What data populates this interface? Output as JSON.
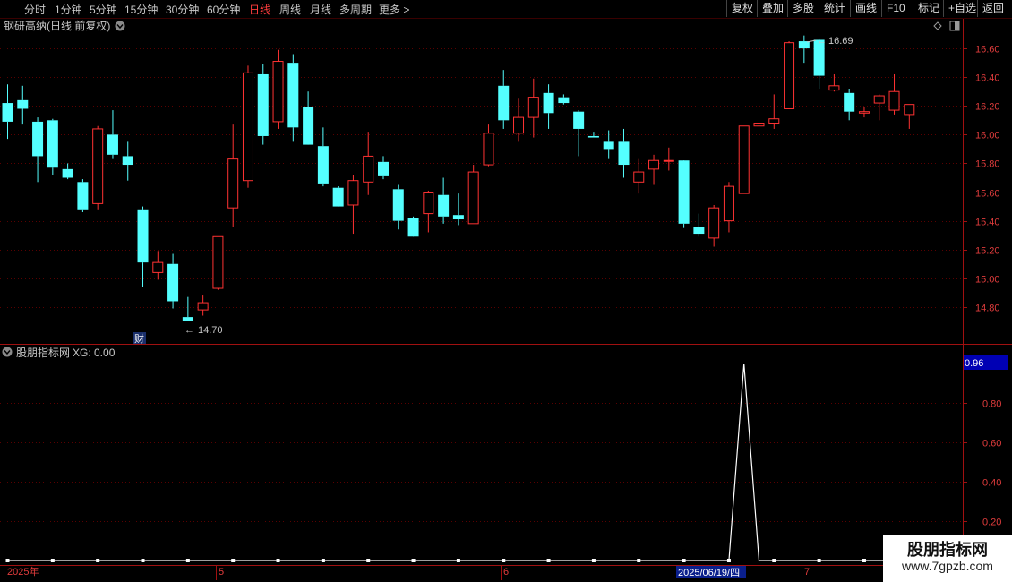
{
  "toolbar": {
    "periods": [
      "分时",
      "1分钟",
      "5分钟",
      "15分钟",
      "30分钟",
      "60分钟",
      "日线",
      "周线",
      "月线",
      "多周期",
      "更多 >"
    ],
    "active_period": "日线",
    "buttons": [
      "复权",
      "叠加",
      "多股",
      "统计",
      "画线",
      "F10",
      "标记",
      "+自选",
      "返回"
    ]
  },
  "main_panel": {
    "title": "钢研高纳(日线 前复权)",
    "y_axis": {
      "ticks": [
        "16.60",
        "16.40",
        "16.20",
        "16.00",
        "15.80",
        "15.60",
        "15.40",
        "15.20",
        "15.00",
        "14.80"
      ],
      "ylim": [
        14.55,
        16.8
      ]
    },
    "high_label": "16.69",
    "low_label": "14.70",
    "cai_badge": "财",
    "up_color": "#ff3232",
    "down_color": "#54ffff"
  },
  "indicator_panel": {
    "title": "股朋指标网",
    "xg_label": "XG: 0.00",
    "current_value_badge": "0.96",
    "y_axis_ticks": [
      "0.80",
      "0.60",
      "0.40",
      "0.20"
    ]
  },
  "x_axis": {
    "labels": [
      "2025年",
      "5",
      "6",
      "7"
    ],
    "highlight_date": "2025/06/19/四"
  },
  "watermark": {
    "line1": "股朋指标网",
    "line2": "www.7gpzb.com"
  },
  "chart_data": {
    "type": "candlestick",
    "ohlc": [
      [
        16.22,
        16.35,
        15.97,
        16.09
      ],
      [
        16.24,
        16.34,
        16.07,
        16.18
      ],
      [
        16.09,
        16.12,
        15.67,
        15.85
      ],
      [
        16.1,
        16.11,
        15.72,
        15.77
      ],
      [
        15.76,
        15.8,
        15.69,
        15.7
      ],
      [
        15.67,
        15.69,
        15.46,
        15.48
      ],
      [
        15.52,
        16.06,
        15.48,
        16.04
      ],
      [
        16.0,
        16.17,
        15.83,
        15.86
      ],
      [
        15.85,
        15.95,
        15.68,
        15.79
      ],
      [
        15.48,
        15.5,
        14.94,
        15.11
      ],
      [
        15.04,
        15.19,
        14.99,
        15.11
      ],
      [
        15.1,
        15.17,
        14.79,
        14.84
      ],
      [
        14.73,
        14.87,
        14.71,
        14.7
      ],
      [
        14.78,
        14.88,
        14.74,
        14.83
      ],
      [
        14.93,
        15.29,
        14.92,
        15.29
      ],
      [
        15.49,
        16.07,
        15.36,
        15.83
      ],
      [
        15.68,
        16.48,
        15.63,
        16.43
      ],
      [
        16.42,
        16.49,
        15.93,
        15.99
      ],
      [
        16.09,
        16.59,
        16.04,
        16.51
      ],
      [
        16.5,
        16.56,
        15.95,
        16.05
      ],
      [
        16.19,
        16.3,
        15.94,
        15.93
      ],
      [
        15.92,
        16.05,
        15.64,
        15.66
      ],
      [
        15.63,
        15.64,
        15.51,
        15.5
      ],
      [
        15.51,
        15.72,
        15.31,
        15.68
      ],
      [
        15.67,
        16.02,
        15.58,
        15.85
      ],
      [
        15.81,
        15.85,
        15.69,
        15.71
      ],
      [
        15.62,
        15.65,
        15.34,
        15.4
      ],
      [
        15.42,
        15.43,
        15.3,
        15.29
      ],
      [
        15.45,
        15.61,
        15.32,
        15.6
      ],
      [
        15.58,
        15.7,
        15.38,
        15.43
      ],
      [
        15.44,
        15.59,
        15.37,
        15.41
      ],
      [
        15.38,
        15.79,
        15.39,
        15.74
      ],
      [
        15.79,
        16.07,
        15.78,
        16.01
      ],
      [
        16.34,
        16.45,
        16.04,
        16.1
      ],
      [
        16.01,
        16.25,
        15.95,
        16.12
      ],
      [
        16.12,
        16.39,
        15.98,
        16.26
      ],
      [
        16.29,
        16.35,
        16.04,
        16.15
      ],
      [
        16.26,
        16.28,
        16.21,
        16.22
      ],
      [
        16.16,
        16.17,
        15.85,
        16.04
      ],
      [
        15.99,
        16.02,
        15.98,
        15.98
      ],
      [
        15.95,
        16.03,
        15.83,
        15.9
      ],
      [
        15.95,
        16.04,
        15.7,
        15.79
      ],
      [
        15.67,
        15.83,
        15.59,
        15.74
      ],
      [
        15.76,
        15.86,
        15.65,
        15.82
      ],
      [
        15.82,
        15.91,
        15.75,
        15.82
      ],
      [
        15.82,
        15.81,
        15.35,
        15.38
      ],
      [
        15.36,
        15.45,
        15.29,
        15.31
      ],
      [
        15.28,
        15.51,
        15.22,
        15.49
      ],
      [
        15.4,
        15.67,
        15.32,
        15.64
      ],
      [
        15.59,
        16.06,
        15.61,
        16.06
      ],
      [
        16.06,
        16.37,
        16.02,
        16.08
      ],
      [
        16.08,
        16.28,
        16.04,
        16.11
      ],
      [
        16.18,
        16.65,
        16.18,
        16.64
      ],
      [
        16.65,
        16.69,
        16.5,
        16.6
      ],
      [
        16.66,
        16.67,
        16.32,
        16.41
      ],
      [
        16.31,
        16.42,
        16.3,
        16.34
      ],
      [
        16.29,
        16.32,
        16.1,
        16.16
      ],
      [
        16.15,
        16.19,
        16.12,
        16.16
      ],
      [
        16.22,
        16.28,
        16.1,
        16.27
      ],
      [
        16.17,
        16.42,
        16.14,
        16.3
      ],
      [
        16.14,
        16.2,
        16.04,
        16.21
      ]
    ],
    "indicator": {
      "name": "XG",
      "values": [
        0,
        0,
        0,
        0,
        0,
        0,
        0,
        0,
        0,
        0,
        0,
        0,
        0,
        0,
        0,
        0,
        0,
        0,
        0,
        0,
        0,
        0,
        0,
        0,
        0,
        0,
        0,
        0,
        0,
        0,
        0,
        0,
        0,
        0,
        0,
        0,
        0,
        0,
        0,
        0,
        0,
        0,
        0,
        0,
        0,
        0,
        0,
        0,
        0,
        1,
        0,
        0,
        0,
        0,
        0,
        0,
        0,
        0,
        0,
        0,
        0
      ],
      "ylim": [
        0,
        1.0
      ]
    }
  }
}
